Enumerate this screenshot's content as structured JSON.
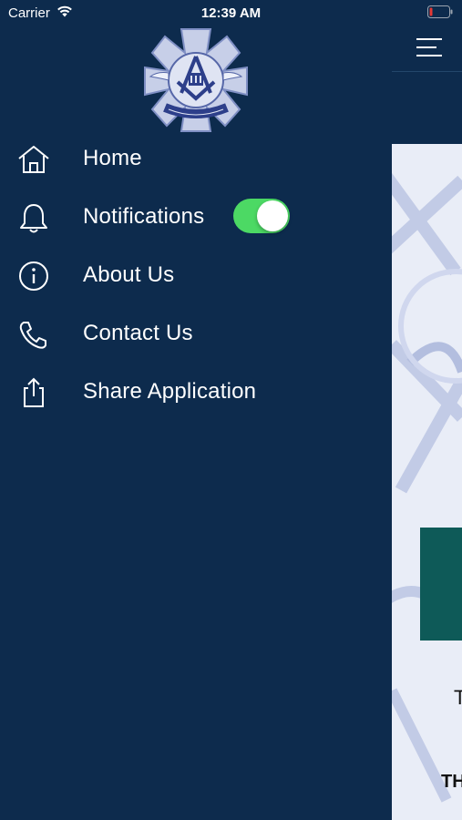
{
  "status_bar": {
    "carrier": "Carrier",
    "time": "12:39 AM",
    "icons": [
      "wifi-icon",
      "battery-low-icon"
    ],
    "battery_color": "#e53935"
  },
  "drawer": {
    "background": "#0d2b4d",
    "logo": {
      "name": "masonic-fire-badge-logo",
      "motto": "THAT OTHERS MAY LIVE"
    },
    "menu": [
      {
        "label": "Home",
        "icon": "home-icon"
      },
      {
        "label": "Notifications",
        "icon": "bell-icon",
        "toggle_on": true
      },
      {
        "label": "About Us",
        "icon": "info-icon"
      },
      {
        "label": "Contact Us",
        "icon": "phone-icon"
      },
      {
        "label": "Share Application",
        "icon": "share-icon"
      }
    ],
    "toggle_color": "#4cd964"
  },
  "page": {
    "header_icon": "hamburger-menu-icon",
    "card_color": "#0e5a58",
    "peek_text_1": "T",
    "peek_text_2": "TH"
  }
}
